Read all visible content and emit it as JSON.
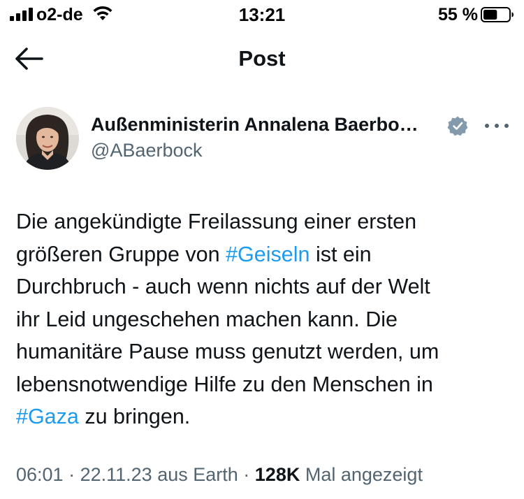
{
  "status_bar": {
    "carrier": "o2-de",
    "time": "13:21",
    "battery_percent": "55 %",
    "battery_level": 0.55,
    "signal_icon": "cellular-signal-icon",
    "wifi_icon": "wifi-icon",
    "battery_icon": "battery-icon"
  },
  "header": {
    "title": "Post",
    "back_icon": "back-arrow-icon"
  },
  "author": {
    "name": "Außenministerin Annalena Baerbo…",
    "handle": "@ABaerbock",
    "verified_icon": "verified-badge-icon",
    "more_icon": "more-options-icon"
  },
  "tweet": {
    "parts": [
      {
        "text": "Die angekündigte Freilassung einer ersten"
      },
      {
        "text": "größeren Gruppe von "
      },
      {
        "hashtag": "#Geiseln"
      },
      {
        "text": " ist ein"
      },
      {
        "text": "Durchbruch - auch wenn nichts auf der Welt"
      },
      {
        "text": "ihr Leid ungeschehen machen kann. Die"
      },
      {
        "text": "humanitäre Pause muss genutzt werden, um"
      },
      {
        "text": "lebensnotwendige Hilfe zu den Menschen in"
      },
      {
        "hashtag": "#Gaza"
      },
      {
        "text": " zu bringen."
      }
    ]
  },
  "meta": {
    "time": "06:01",
    "separator": " · ",
    "date": "22.11.23",
    "source": "aus Earth",
    "views_count": "128K",
    "views_label": "Mal angezeigt"
  },
  "colors": {
    "hashtag": "#1d9bf0",
    "secondary_text": "#536471",
    "primary_text": "#0f1419",
    "verified_badge": "#829aab"
  }
}
